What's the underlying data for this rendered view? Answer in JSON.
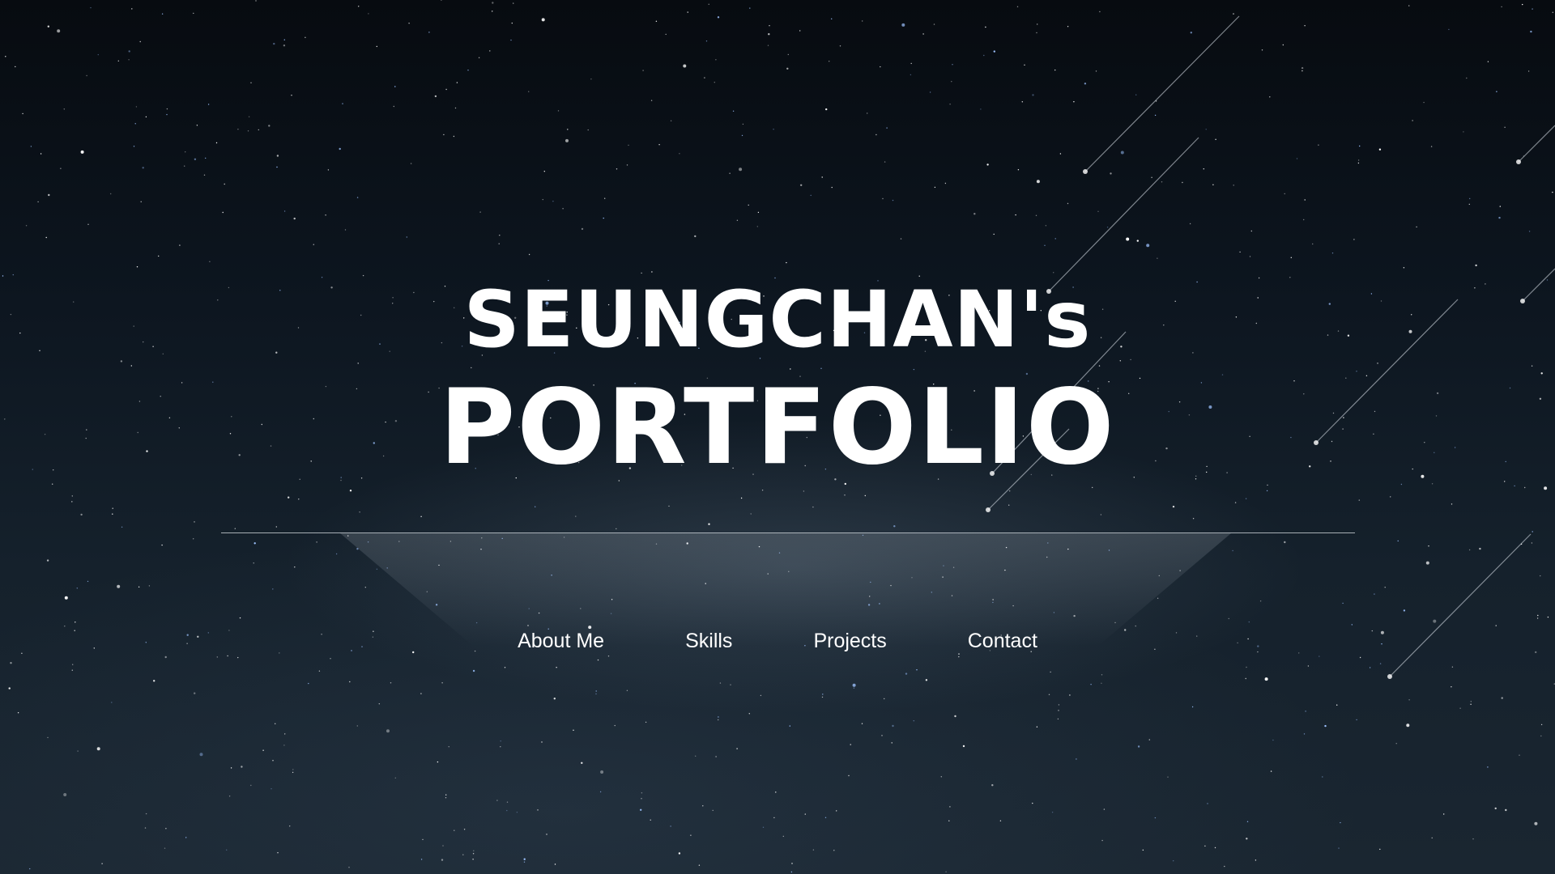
{
  "hero": {
    "line1": "SEUNGCHAN's",
    "line2": "PORTFOLIO"
  },
  "nav": {
    "items": [
      {
        "label": "About Me"
      },
      {
        "label": "Skills"
      },
      {
        "label": "Projects"
      },
      {
        "label": "Contact"
      }
    ]
  },
  "theme": {
    "background": "#0d1620",
    "text": "#ffffff",
    "star": "#ffffff",
    "star_accent": "#9ec3ff"
  }
}
